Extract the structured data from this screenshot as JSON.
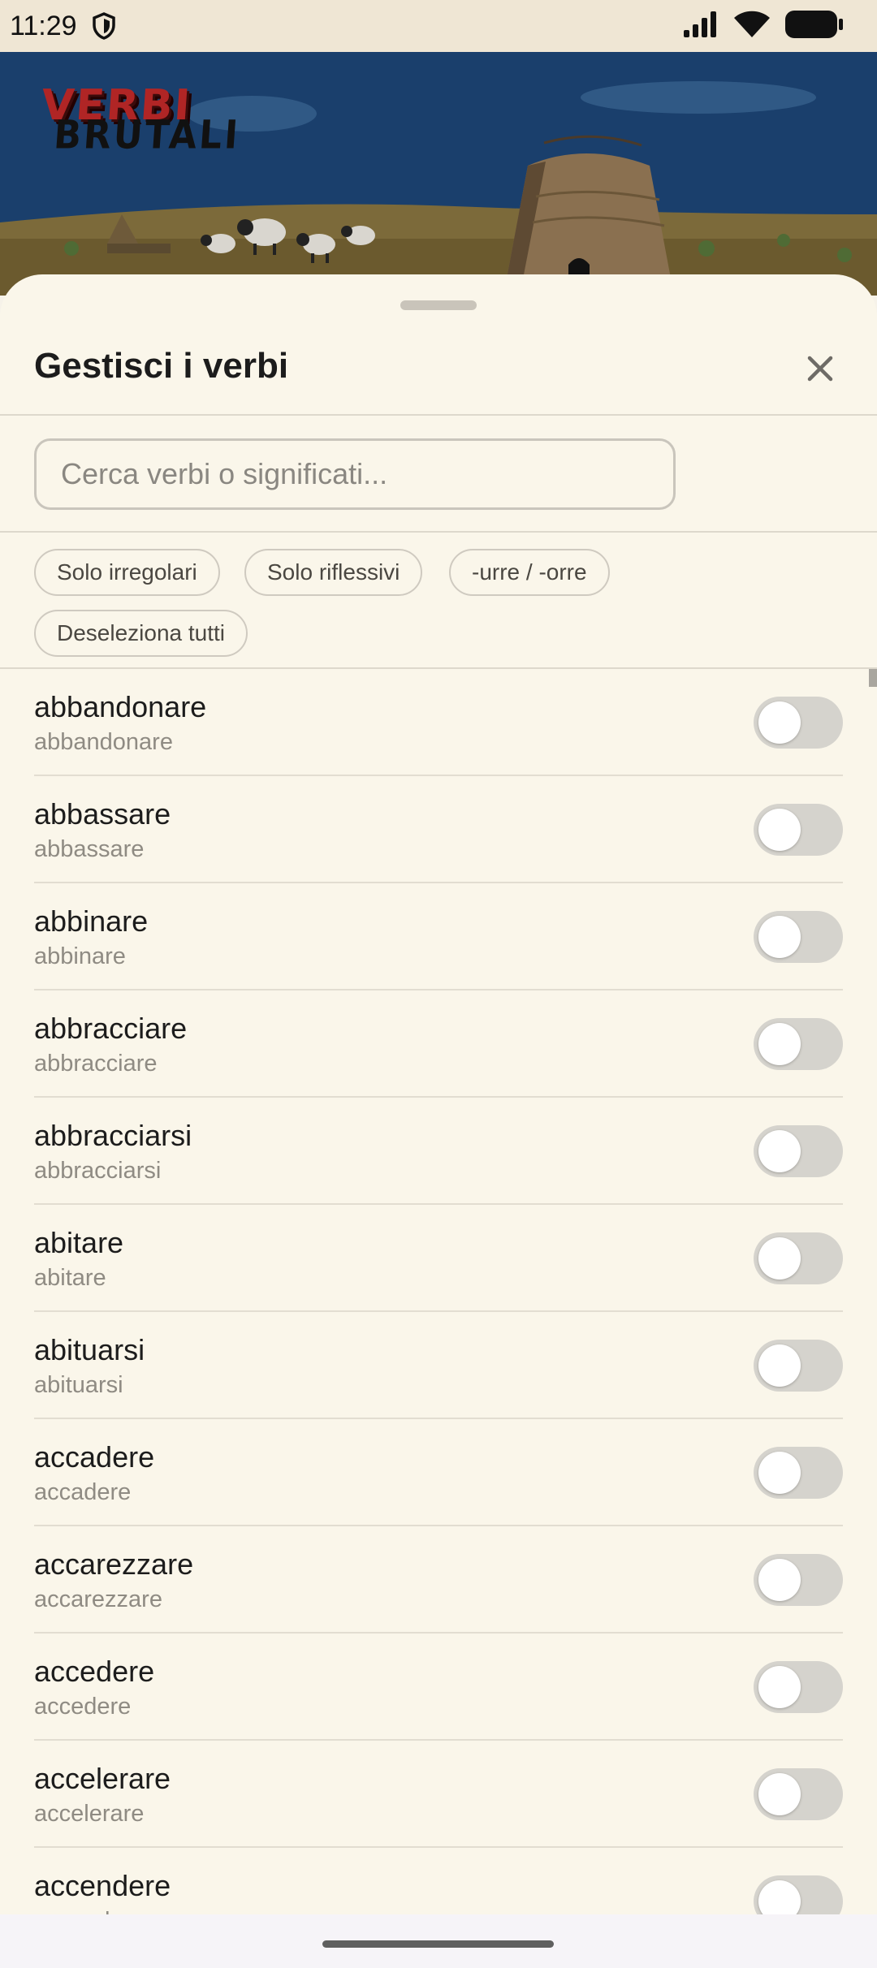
{
  "status_bar": {
    "time": "11:29",
    "icons": [
      "shield-icon",
      "signal-icon",
      "wifi-icon",
      "battery-icon"
    ]
  },
  "hero": {
    "logo_line1": "VERBI",
    "logo_line2": "BRUTALI"
  },
  "sheet": {
    "title": "Gestisci i verbi",
    "close_icon": "close-icon",
    "search_placeholder": "Cerca verbi o significati...",
    "filters": [
      {
        "label": "Solo irregolari"
      },
      {
        "label": "Solo riflessivi"
      },
      {
        "label": "-urre / -orre"
      },
      {
        "label": "Deseleziona tutti"
      }
    ],
    "verbs": [
      {
        "verb": "abbandonare",
        "meaning": "abbandonare",
        "enabled": false
      },
      {
        "verb": "abbassare",
        "meaning": "abbassare",
        "enabled": false
      },
      {
        "verb": "abbinare",
        "meaning": "abbinare",
        "enabled": false
      },
      {
        "verb": "abbracciare",
        "meaning": "abbracciare",
        "enabled": false
      },
      {
        "verb": "abbracciarsi",
        "meaning": "abbracciarsi",
        "enabled": false
      },
      {
        "verb": "abitare",
        "meaning": "abitare",
        "enabled": false
      },
      {
        "verb": "abituarsi",
        "meaning": "abituarsi",
        "enabled": false
      },
      {
        "verb": "accadere",
        "meaning": "accadere",
        "enabled": false
      },
      {
        "verb": "accarezzare",
        "meaning": "accarezzare",
        "enabled": false
      },
      {
        "verb": "accedere",
        "meaning": "accedere",
        "enabled": false
      },
      {
        "verb": "accelerare",
        "meaning": "accelerare",
        "enabled": false
      },
      {
        "verb": "accendere",
        "meaning": "accendere",
        "enabled": false
      }
    ]
  },
  "colors": {
    "sheet_background": "#faf6ea",
    "toggle_off": "#d5d3cd",
    "hero_sky": "#1a3f6c",
    "logo_red": "#b02525"
  }
}
